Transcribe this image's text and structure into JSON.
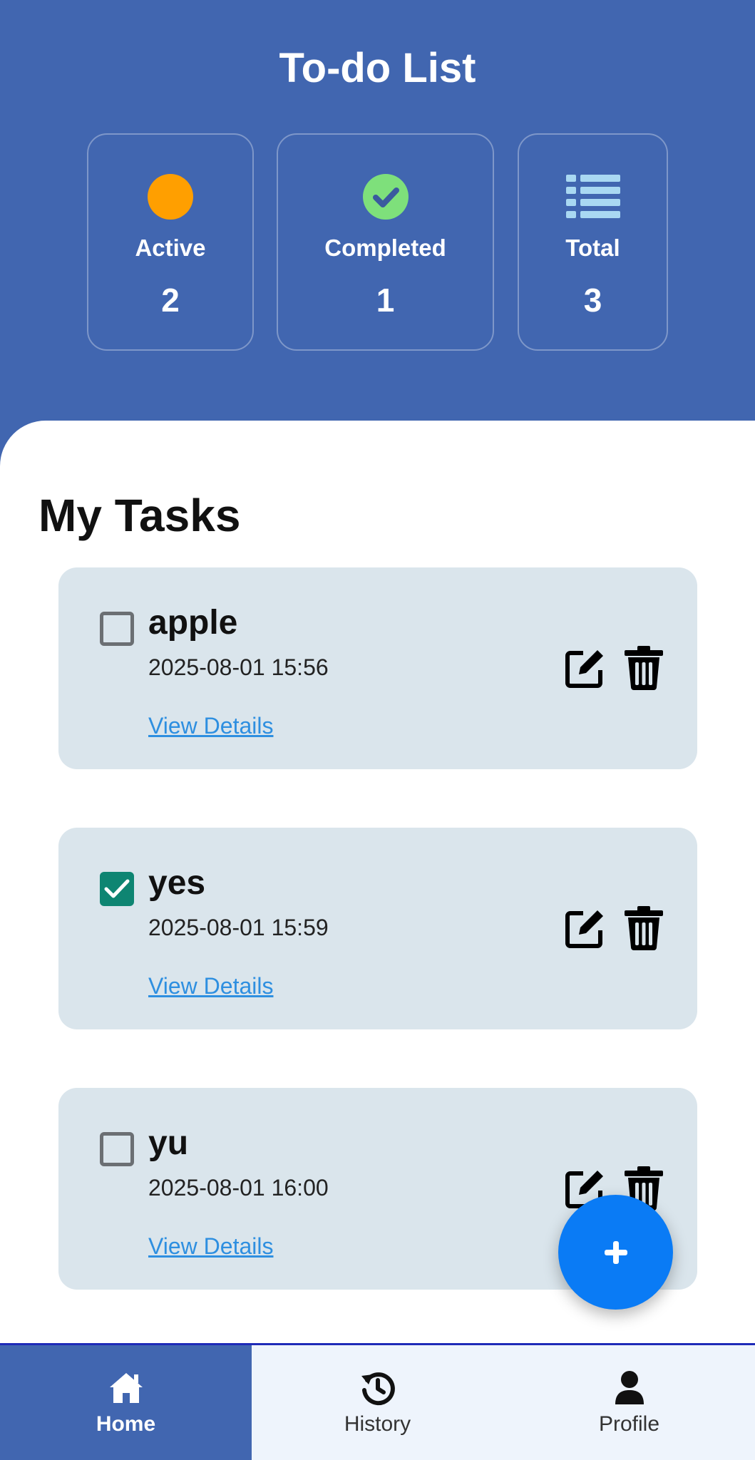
{
  "header": {
    "title": "To-do List"
  },
  "stats": {
    "active": {
      "label": "Active",
      "value": "2",
      "icon": "orange-dot-icon"
    },
    "completed": {
      "label": "Completed",
      "value": "1",
      "icon": "check-circle-icon"
    },
    "total": {
      "label": "Total",
      "value": "3",
      "icon": "list-icon"
    }
  },
  "tasks_section": {
    "title": "My Tasks",
    "tasks": [
      {
        "name": "apple",
        "date": "2025-08-01 15:56",
        "completed": false,
        "link": "View Details"
      },
      {
        "name": "yes",
        "date": "2025-08-01 15:59",
        "completed": true,
        "link": "View Details"
      },
      {
        "name": "yu",
        "date": "2025-08-01 16:00",
        "completed": false,
        "link": "View Details"
      }
    ]
  },
  "fab": {
    "icon": "plus-icon",
    "label": "+"
  },
  "bottom_nav": {
    "items": [
      {
        "label": "Home",
        "icon": "home-icon",
        "active": true
      },
      {
        "label": "History",
        "icon": "history-icon",
        "active": false
      },
      {
        "label": "Profile",
        "icon": "profile-icon",
        "active": false
      }
    ]
  },
  "colors": {
    "primary": "#4166B0",
    "card_bg": "#DAE5EC",
    "active_dot": "#FF9F00",
    "completed_icon": "#7EE07B",
    "total_icon": "#A9D8F2",
    "checkbox_checked": "#0E8572",
    "link": "#2E8FE0",
    "fab": "#0A7BF5"
  }
}
